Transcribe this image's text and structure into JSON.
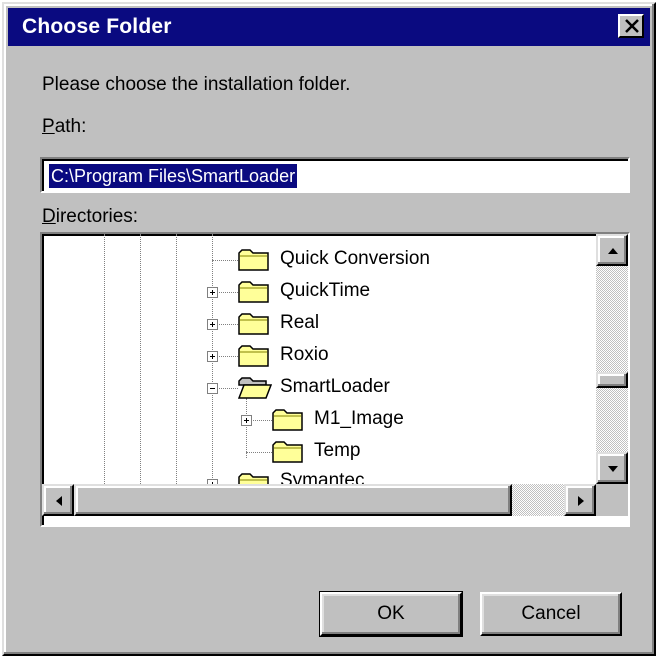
{
  "dialog": {
    "title": "Choose Folder",
    "close_glyph": "close-icon",
    "prompt": "Please choose the installation folder.",
    "path_label_accel": "P",
    "path_label_rest": "ath:",
    "path_value": "C:\\Program Files\\SmartLoader",
    "dirs_label_accel": "D",
    "dirs_label_rest": "irectories:"
  },
  "tree": {
    "items": [
      {
        "label": "Quick Conversion",
        "level": 0,
        "expander": "none",
        "folder": "closed"
      },
      {
        "label": "QuickTime",
        "level": 0,
        "expander": "plus",
        "folder": "closed"
      },
      {
        "label": "Real",
        "level": 0,
        "expander": "plus",
        "folder": "closed"
      },
      {
        "label": "Roxio",
        "level": 0,
        "expander": "plus",
        "folder": "closed"
      },
      {
        "label": "SmartLoader",
        "level": 0,
        "expander": "minus",
        "folder": "open"
      },
      {
        "label": "M1_Image",
        "level": 1,
        "expander": "plus",
        "folder": "closed"
      },
      {
        "label": "Temp",
        "level": 1,
        "expander": "none",
        "folder": "closed"
      },
      {
        "label": "Symantec",
        "level": 0,
        "expander": "plus",
        "folder": "closed"
      }
    ]
  },
  "buttons": {
    "ok": "OK",
    "cancel": "Cancel"
  },
  "colors": {
    "face": "#c0c0c0",
    "titlebar": "#0a0a80",
    "selection": "#0a0a80",
    "folder_fill": "#ffff99"
  }
}
